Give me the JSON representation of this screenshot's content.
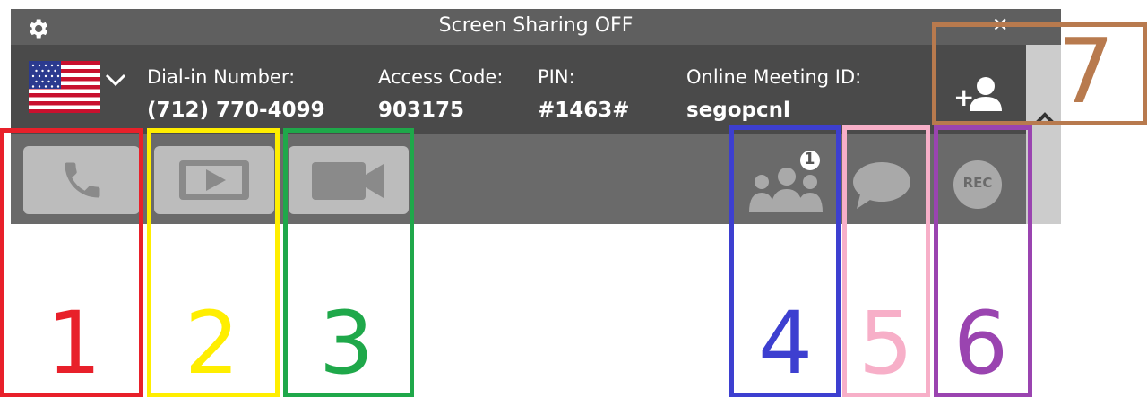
{
  "window": {
    "title": "Screen Sharing OFF",
    "controls": {
      "minimize": "—",
      "close": "✕"
    }
  },
  "meeting_info": {
    "country": "United States",
    "dial_in": {
      "label": "Dial-in Number:",
      "value": "(712) 770-4099"
    },
    "access_code": {
      "label": "Access Code:",
      "value": "903175"
    },
    "pin": {
      "label": "PIN:",
      "value": "#1463#"
    },
    "meeting_id": {
      "label": "Online Meeting ID:",
      "value": "segopcnl"
    }
  },
  "toolbar": {
    "items": [
      {
        "name": "phone",
        "icon": "phone-icon"
      },
      {
        "name": "screen-share",
        "icon": "play-screen-icon"
      },
      {
        "name": "video",
        "icon": "video-camera-icon"
      },
      {
        "name": "participants",
        "icon": "participants-icon",
        "badge": "1"
      },
      {
        "name": "chat",
        "icon": "chat-bubble-icon"
      },
      {
        "name": "record",
        "icon": "record-icon",
        "label": "REC"
      },
      {
        "name": "add-participant",
        "icon": "add-user-icon"
      }
    ]
  },
  "annotations": [
    {
      "number": "1",
      "color": "#e8202a"
    },
    {
      "number": "2",
      "color": "#ffee00"
    },
    {
      "number": "3",
      "color": "#1fa84a"
    },
    {
      "number": "4",
      "color": "#3d3fd0"
    },
    {
      "number": "5",
      "color": "#f7afc8"
    },
    {
      "number": "6",
      "color": "#9a44b0"
    },
    {
      "number": "7",
      "color": "#b87a4e"
    }
  ],
  "colors": {
    "titlebar": "#5f5f5f",
    "infobar": "#4a4a4a",
    "toolbar": "#6a6a6a",
    "button": "#bcbcbc",
    "icon": "#8a8a8a"
  }
}
